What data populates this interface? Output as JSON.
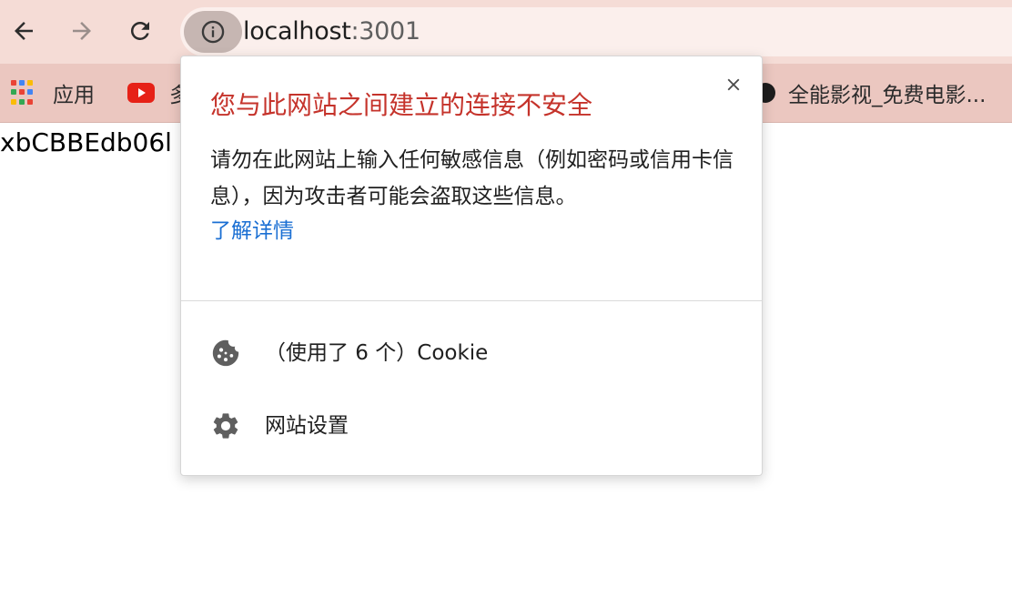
{
  "toolbar": {
    "back_icon": "arrow-left-icon",
    "forward_icon": "arrow-right-icon",
    "reload_icon": "reload-icon",
    "site_info_icon": "info-icon",
    "url_host": "localhost",
    "url_port": ":3001"
  },
  "bookmarks": {
    "items": [
      {
        "label": "应用",
        "icon": "apps-grid-icon"
      },
      {
        "label": "多",
        "icon": "youtube-icon"
      },
      {
        "label": "全能影视_免费电影...",
        "icon": "site-icon"
      }
    ]
  },
  "page": {
    "visible_text": "xbCBBEdb06l"
  },
  "popup": {
    "title": "您与此网站之间建立的连接不安全",
    "description": "请勿在此网站上输入任何敏感信息（例如密码或信用卡信息），因为攻击者可能会盗取这些信息。",
    "learn_more": "了解详情",
    "cookies_label": "（使用了 6 个）Cookie",
    "site_settings_label": "网站设置",
    "close_icon": "close-icon",
    "colors": {
      "title": "#c5332b",
      "link": "#1a6fd3"
    }
  }
}
